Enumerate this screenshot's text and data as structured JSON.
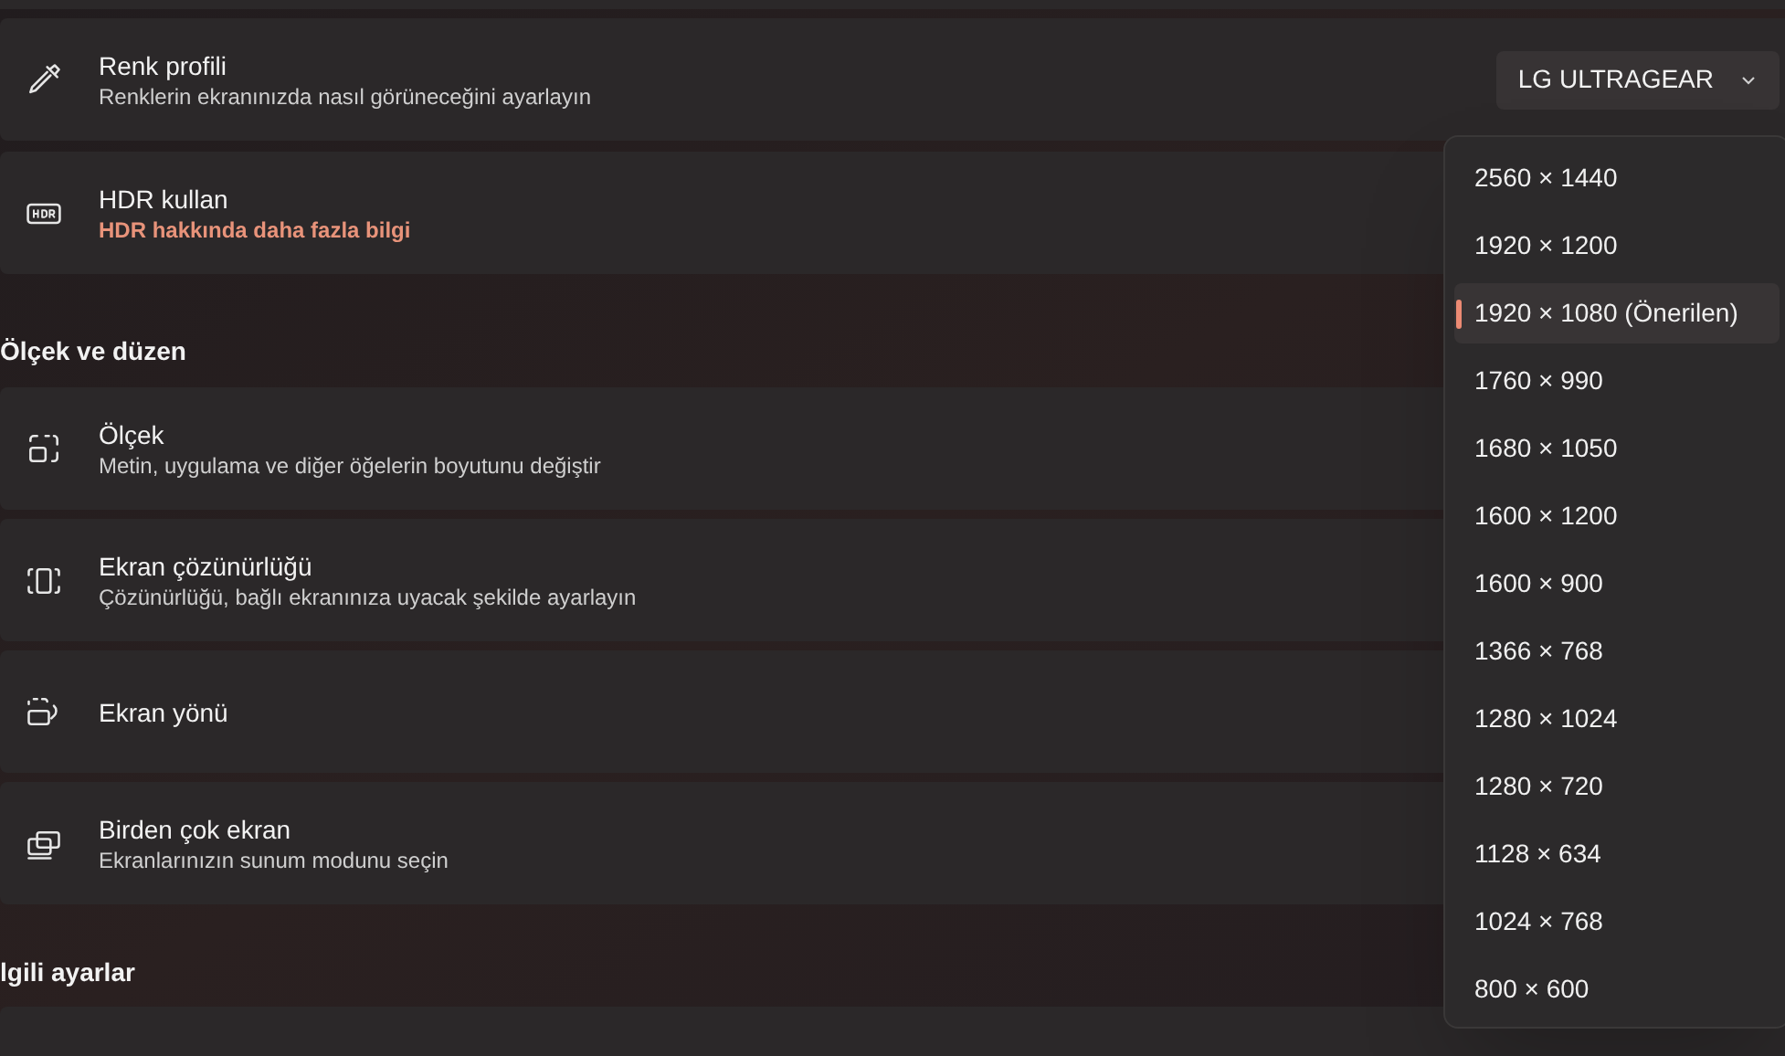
{
  "rows_top": [
    {
      "kind": "dropdown",
      "title": "Renk profili",
      "subtitle": "Renklerin ekranınızda nasıl görüneceğini ayarlayın",
      "value": "LG ULTRAGEAR"
    },
    {
      "kind": "link",
      "title": "HDR kullan",
      "subtitle": "HDR hakkında daha fazla bilgi"
    }
  ],
  "section_1": {
    "title": "Ölçek ve düzen",
    "rows": [
      {
        "title": "Ölçek",
        "subtitle": "Metin, uygulama ve diğer öğelerin boyutunu değiştir"
      },
      {
        "title": "Ekran çözünürlüğü",
        "subtitle": "Çözünürlüğü, bağlı ekranınıza uyacak şekilde ayarlayın"
      },
      {
        "title": "Ekran yönü"
      },
      {
        "title": "Birden çok ekran",
        "subtitle": "Ekranlarınızın sunum modunu seçin"
      }
    ]
  },
  "section_2": {
    "title": "lgili ayarlar"
  },
  "resolution_menu": [
    {
      "label": "2560 × 1440",
      "selected": false
    },
    {
      "label": "1920 × 1200",
      "selected": false
    },
    {
      "label": "1920 × 1080 (Önerilen)",
      "selected": true
    },
    {
      "label": "1760 × 990",
      "selected": false
    },
    {
      "label": "1680 × 1050",
      "selected": false
    },
    {
      "label": "1600 × 1200",
      "selected": false
    },
    {
      "label": "1600 × 900",
      "selected": false
    },
    {
      "label": "1366 × 768",
      "selected": false
    },
    {
      "label": "1280 × 1024",
      "selected": false
    },
    {
      "label": "1280 × 720",
      "selected": false
    },
    {
      "label": "1128 × 634",
      "selected": false
    },
    {
      "label": "1024 × 768",
      "selected": false
    },
    {
      "label": "800 × 600",
      "selected": false
    }
  ]
}
